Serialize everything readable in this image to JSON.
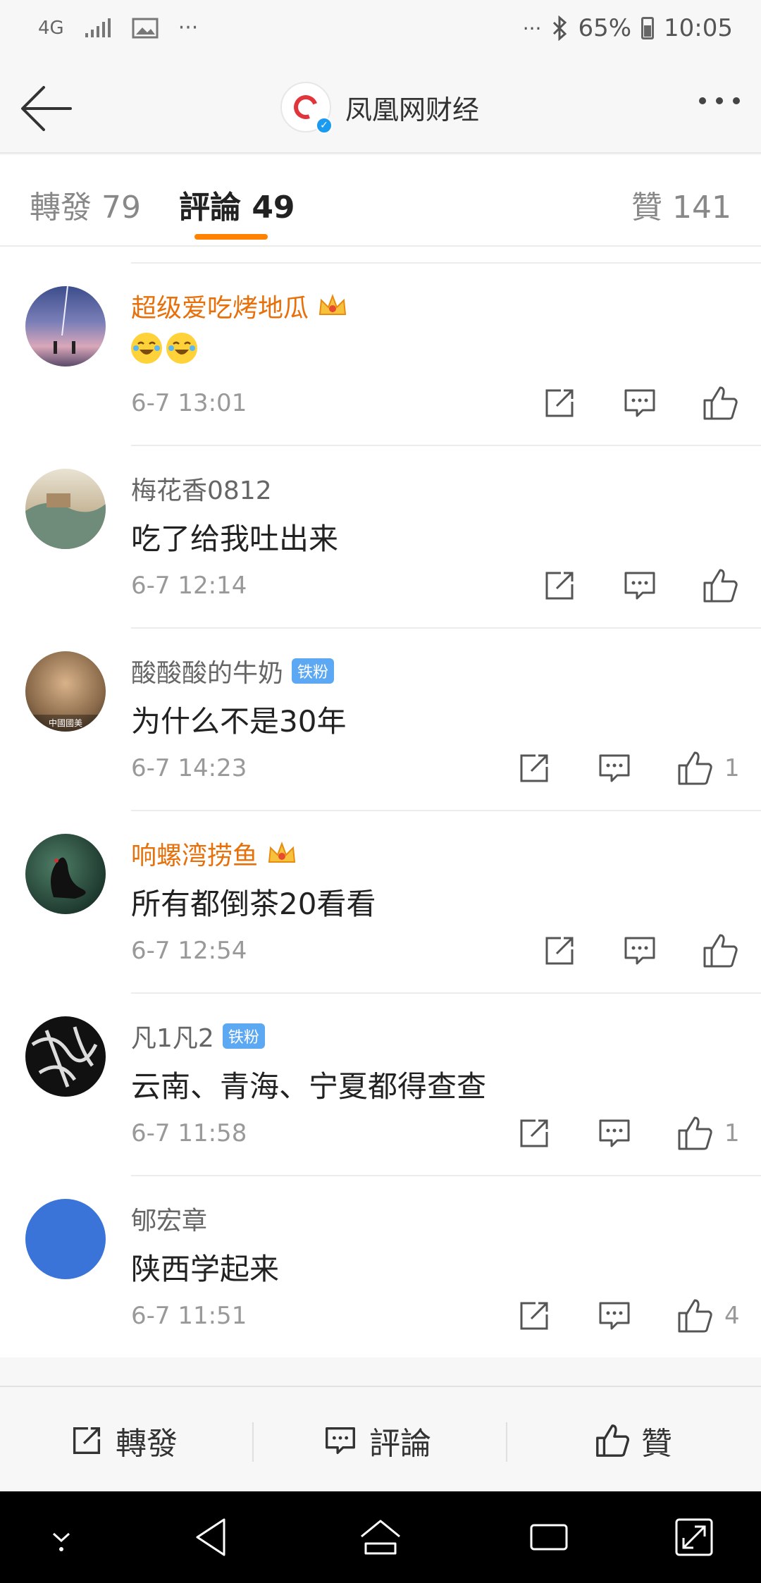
{
  "status_bar": {
    "network": "4G",
    "more": "···",
    "more_right": "···",
    "battery": "65%",
    "time": "10:05"
  },
  "nav": {
    "title": "凤凰网财经",
    "logo_label": "鳳凰網財經"
  },
  "tabs": {
    "repost": "轉發 79",
    "comment": "評論 49",
    "like": "贊 141"
  },
  "comments": [
    {
      "user": "超级爱吃烤地瓜",
      "vip": true,
      "badge": "",
      "text": "",
      "emoji_count": 2,
      "time": "6-7 13:01",
      "likes": ""
    },
    {
      "user": "梅花香0812",
      "vip": false,
      "badge": "",
      "text": "吃了给我吐出来",
      "time": "6-7 12:14",
      "likes": ""
    },
    {
      "user": "酸酸酸的牛奶",
      "vip": false,
      "badge": "铁粉",
      "text": "为什么不是30年",
      "time": "6-7 14:23",
      "likes": "1",
      "avatar_caption": "中國國美"
    },
    {
      "user": "响螺湾捞鱼",
      "vip": true,
      "badge": "",
      "text": "所有都倒茶20看看",
      "time": "6-7 12:54",
      "likes": ""
    },
    {
      "user": "凡1凡2",
      "vip": false,
      "badge": "铁粉",
      "text": "云南、青海、宁夏都得查查",
      "time": "6-7 11:58",
      "likes": "1"
    },
    {
      "user": "郇宏章",
      "vip": false,
      "badge": "",
      "text": "陕西学起来",
      "time": "6-7 11:51",
      "likes": "4"
    }
  ],
  "bottom_bar": {
    "repost": "轉發",
    "comment": "評論",
    "like": "贊"
  },
  "colors": {
    "accent": "#ff8200",
    "vip_name": "#e8700a",
    "badge": "#5da8f2"
  }
}
